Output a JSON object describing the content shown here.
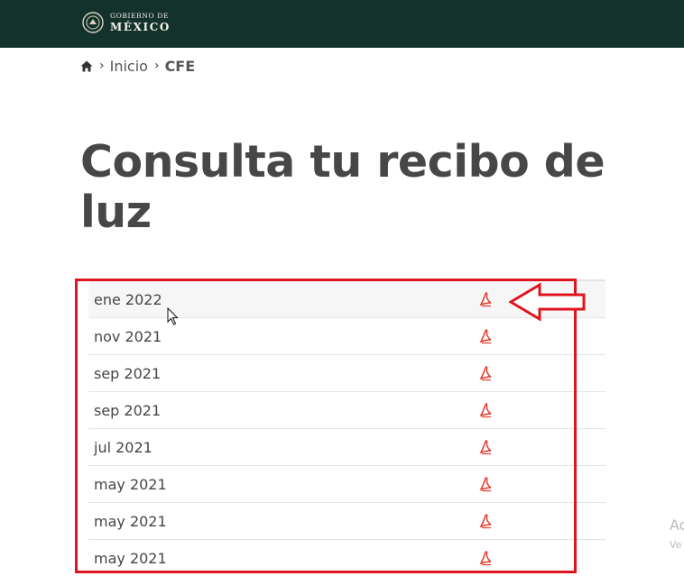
{
  "header": {
    "logo_line1": "GOBIERNO DE",
    "logo_line2": "MÉXICO",
    "background": "#13322b"
  },
  "breadcrumb": {
    "home_icon": "home-icon",
    "items": [
      "Inicio",
      "CFE"
    ]
  },
  "page": {
    "title": "Consulta tu recibo de luz"
  },
  "receipts": [
    {
      "label": "ene 2022",
      "icon": "pdf-icon"
    },
    {
      "label": "nov 2021",
      "icon": "pdf-icon"
    },
    {
      "label": "sep 2021",
      "icon": "pdf-icon"
    },
    {
      "label": "sep 2021",
      "icon": "pdf-icon"
    },
    {
      "label": "jul 2021",
      "icon": "pdf-icon"
    },
    {
      "label": "may 2021",
      "icon": "pdf-icon"
    },
    {
      "label": "may 2021",
      "icon": "pdf-icon"
    },
    {
      "label": "may 2021",
      "icon": "pdf-icon"
    }
  ],
  "annotation": {
    "color": "#e0141e"
  },
  "overlay": {
    "watermark_line1": "Ac",
    "watermark_line2": "Ve"
  }
}
